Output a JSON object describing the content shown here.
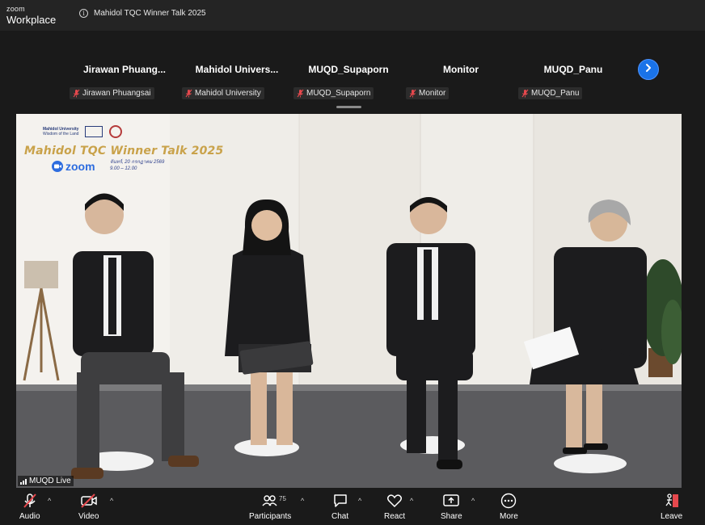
{
  "app": {
    "brand_top": "zoom",
    "brand_bottom": "Workplace"
  },
  "meeting": {
    "title": "Mahidol TQC Winner Talk 2025"
  },
  "gallery": {
    "participants": [
      {
        "name": "Jirawan  Phuang...",
        "label": "Jirawan Phuangsai",
        "muted": true
      },
      {
        "name": "Mahidol  Univers...",
        "label": "Mahidol University",
        "muted": true
      },
      {
        "name": "MUQD_Supaporn",
        "label": "MUQD_Supaporn",
        "muted": true
      },
      {
        "name": "Monitor",
        "label": "Monitor",
        "muted": true
      },
      {
        "name": "MUQD_Panu",
        "label": "MUQD_Panu",
        "muted": true
      }
    ],
    "next_icon": "chevron-right-icon"
  },
  "video": {
    "speaker_label": "MUQD Live",
    "banner": {
      "title": "Mahidol TQC Winner Talk 2025",
      "zoom_text": "zoom",
      "date_line": "จันทร์, 20 กรกฎาคม 2569",
      "time_line": "9.00 – 12.00",
      "logo1": "Mahidol University",
      "logo1_sub": "Wisdom of the Land"
    }
  },
  "toolbar": {
    "audio_label": "Audio",
    "video_label": "Video",
    "participants_label": "Participants",
    "participants_count": "75",
    "chat_label": "Chat",
    "react_label": "React",
    "share_label": "Share",
    "more_label": "More",
    "leave_label": "Leave",
    "caret": "^"
  },
  "colors": {
    "accent_blue": "#1a73e8",
    "muted_red": "#e5484d",
    "bar_bg": "#1a1a1a"
  }
}
